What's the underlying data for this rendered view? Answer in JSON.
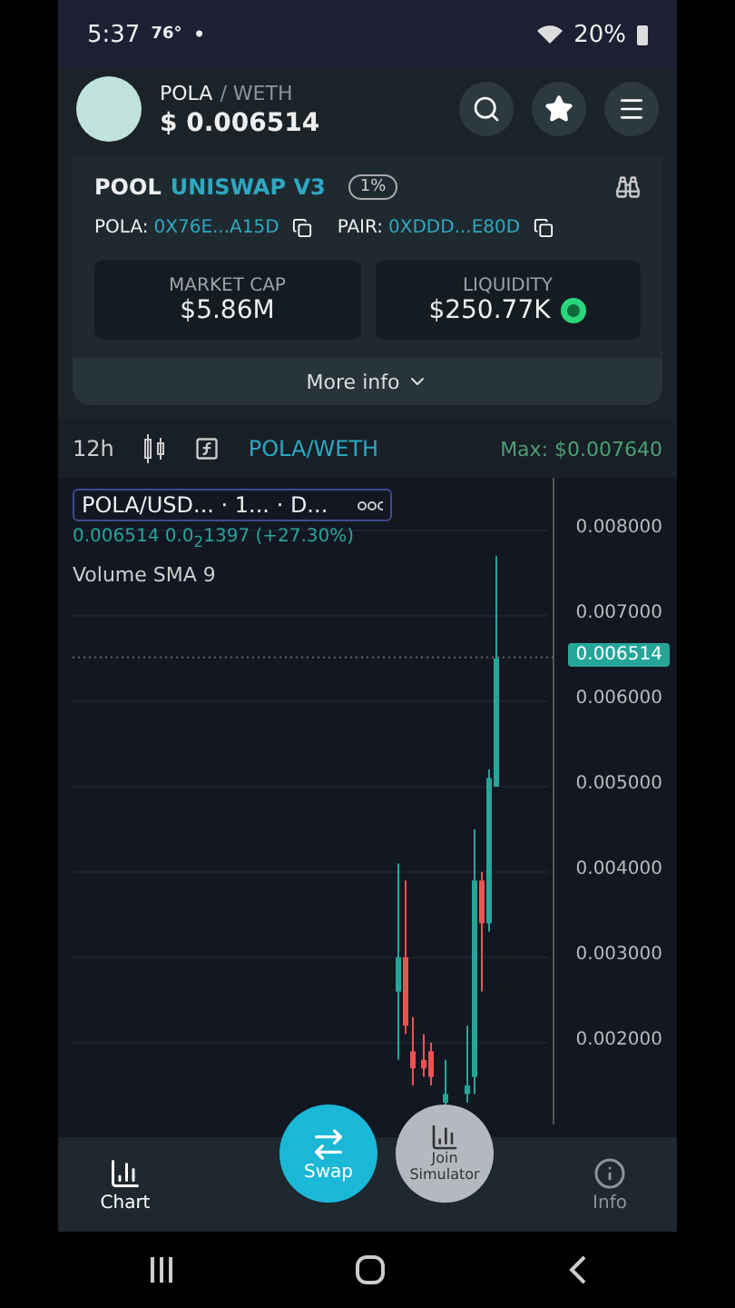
{
  "status_bar": {
    "time": "5:37",
    "temperature": "76°",
    "dot": "•",
    "battery": "20%"
  },
  "header": {
    "base": "POLA",
    "quote": "/ WETH",
    "price": "$ 0.006514"
  },
  "pool": {
    "label": "POOL",
    "dex": "UNISWAP V3",
    "fee": "1%",
    "addresses": [
      {
        "label": "POLA:",
        "value": "0X76E...A15D"
      },
      {
        "label": "PAIR:",
        "value": "0XDDD...E80D"
      }
    ],
    "stats": [
      {
        "label": "MARKET CAP",
        "value": "$5.86M",
        "kind": "plain"
      },
      {
        "label": "LIQUIDITY",
        "value": "$250.77K",
        "kind": "locked"
      }
    ],
    "more": "More info"
  },
  "chart_toolbar": {
    "interval": "12h",
    "pair": "POLA/WETH",
    "max": "Max: $0.007640"
  },
  "chart": {
    "legend": "POLA/USD... · 1... · D...",
    "quote": "0.006514  0.0$_{2}$1397 (+27.30%)",
    "volume": "Volume SMA 9",
    "price_axis": [
      "0.008000",
      "0.007000",
      "0.006000",
      "0.005000",
      "0.004000",
      "0.003000",
      "0.002000"
    ],
    "last_price": "0.006514"
  },
  "nav": [
    {
      "label": "Chart",
      "kind": "tab",
      "selected": true
    },
    {
      "label": "Swap",
      "kind": "swap"
    },
    {
      "label": "Join Simulator",
      "kind": "sim"
    },
    {
      "label": "Info",
      "kind": "tab",
      "selected": false
    }
  ]
}
